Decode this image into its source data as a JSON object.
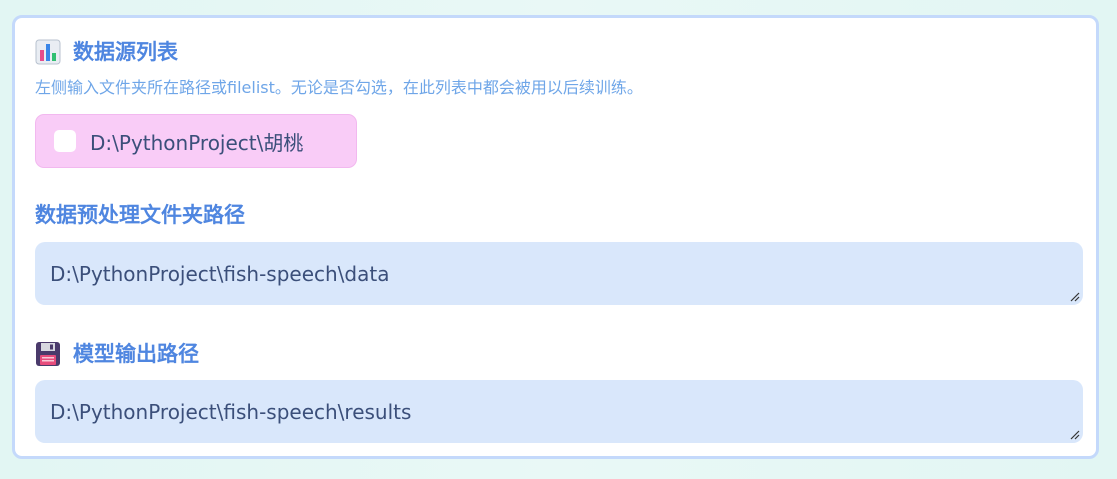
{
  "data_source": {
    "icon": "bar-chart-icon",
    "title": "数据源列表",
    "description": "左侧输入文件夹所在路径或filelist。无论是否勾选，在此列表中都会被用以后续训练。",
    "items": [
      {
        "label": "D:\\PythonProject\\胡桃",
        "checked": false
      }
    ]
  },
  "preprocess": {
    "title": "数据预处理文件夹路径",
    "value": "D:\\PythonProject\\fish-speech\\data"
  },
  "model_output": {
    "icon": "floppy-disk-icon",
    "title": "模型输出路径",
    "value": "D:\\PythonProject\\fish-speech\\results"
  },
  "colors": {
    "accent": "#4f86e0",
    "description": "#6fa6e8",
    "chip_bg": "#f9ccf7",
    "input_bg": "#d9e7fb",
    "panel_border": "#c4d9fb"
  }
}
